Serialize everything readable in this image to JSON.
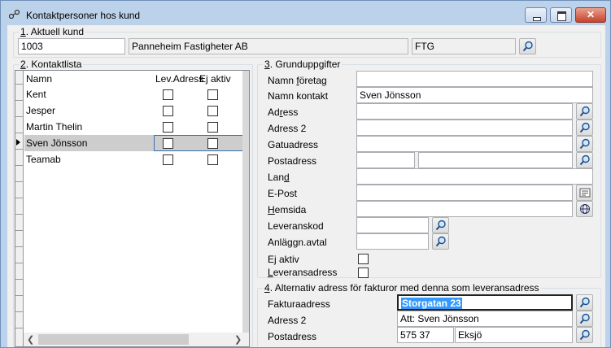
{
  "window": {
    "title": "Kontaktpersoner hos kund",
    "minimize": "minimize",
    "maximize": "maximize",
    "close": "close"
  },
  "current_customer": {
    "legend": "1. Aktuell kund",
    "number": "1003",
    "name": "Panneheim Fastigheter AB",
    "code": "FTG"
  },
  "contact_list": {
    "legend": "2. Kontaktlista",
    "columns": [
      "Namn",
      "Lev.Adress",
      "Ej aktiv"
    ],
    "rows": [
      {
        "name": "Kent",
        "lev_adress": false,
        "ej_aktiv": false
      },
      {
        "name": "Jesper",
        "lev_adress": false,
        "ej_aktiv": false
      },
      {
        "name": "Martin Thelin",
        "lev_adress": false,
        "ej_aktiv": false
      },
      {
        "name": "Sven Jönsson",
        "lev_adress": false,
        "ej_aktiv": false,
        "selected": true
      },
      {
        "name": "Teamab",
        "lev_adress": false,
        "ej_aktiv": false
      }
    ]
  },
  "basic_info": {
    "legend": "3. Grunduppgifter",
    "labels": {
      "namn_foretag": "Namn företag",
      "namn_kontakt": "Namn kontakt",
      "adress": "Adress",
      "adress2": "Adress 2",
      "gatuadress": "Gatuadress",
      "postadress": "Postadress",
      "land": "Land",
      "epost": "E-Post",
      "hemsida": "Hemsida",
      "leveranskod": "Leveranskod",
      "anlaggn_avtal": "Anläggn.avtal",
      "ej_aktiv": "Ej aktiv",
      "leveransadress": "Leveransadress"
    },
    "values": {
      "namn_foretag": "",
      "namn_kontakt": "Sven Jönsson",
      "adress": "",
      "adress2": "",
      "gatuadress": "",
      "postnr": "",
      "ort": "",
      "land": "",
      "epost": "",
      "hemsida": "",
      "leveranskod": "",
      "anlaggn_avtal": ""
    }
  },
  "alt_address": {
    "legend": "4. Alternativ adress för fakturor med denna som leveransadress",
    "labels": {
      "fakturaadress": "Fakturaadress",
      "adress2": "Adress 2",
      "postadress": "Postadress"
    },
    "values": {
      "fakturaadress": "Storgatan 23",
      "adress2": "Att: Sven Jönsson",
      "postnr": "575 37",
      "ort": "Eksjö"
    }
  },
  "icons": {
    "lookup": "magnifier-icon",
    "email": "email-form-icon",
    "web": "web-globe-icon"
  },
  "colors": {
    "title_bar": "#bcd1ea",
    "selection": "#3399ff",
    "selected_row": "#cdcdcd"
  }
}
